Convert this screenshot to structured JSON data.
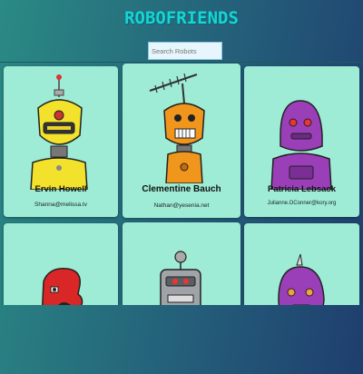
{
  "app": {
    "title": "ROBOFRIENDS"
  },
  "search": {
    "placeholder": "Search Robots",
    "value": ""
  },
  "robots": [
    {
      "name": "Ervin Howell",
      "email": "Shanna@melissa.tv"
    },
    {
      "name": "Clementine Bauch",
      "email": "Nathan@yesenia.net"
    },
    {
      "name": "Patricia Lebsack",
      "email": "Julianne.OConner@kory.org"
    },
    {
      "name": "",
      "email": ""
    },
    {
      "name": "",
      "email": ""
    },
    {
      "name": "",
      "email": ""
    }
  ],
  "colors": {
    "card_bg": "#9eecd5",
    "title": "#18d4d2",
    "bg_start": "#2a8a84",
    "bg_end": "#1f3e6e"
  }
}
